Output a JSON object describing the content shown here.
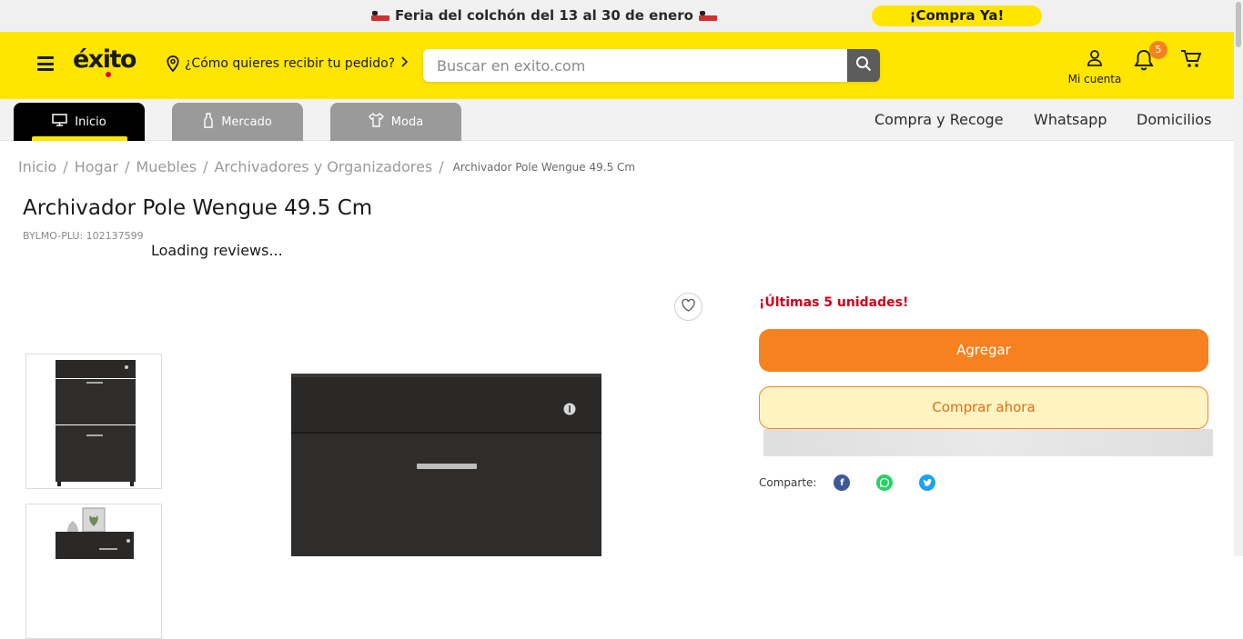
{
  "promo": {
    "text": "Feria del colchón del 13 al 30 de enero",
    "cta": "¡Compra Ya!"
  },
  "header": {
    "logo": "éxito",
    "delivery_prompt": "¿Cómo quieres recibir tu pedido?",
    "search_placeholder": "Buscar en exito.com",
    "account_label": "Mi cuenta",
    "notifications_count": "5"
  },
  "nav": {
    "tabs": [
      {
        "label": "Inicio",
        "icon": "monitor-icon",
        "active": true
      },
      {
        "label": "Mercado",
        "icon": "bottle-icon",
        "active": false
      },
      {
        "label": "Moda",
        "icon": "shirt-icon",
        "active": false
      }
    ],
    "links": [
      "Compra y Recoge",
      "Whatsapp",
      "Domicilios"
    ]
  },
  "breadcrumb": {
    "items": [
      "Inicio",
      "Hogar",
      "Muebles",
      "Archivadores y Organizadores"
    ],
    "current": "Archivador Pole Wengue 49.5 Cm"
  },
  "product": {
    "title": "Archivador Pole Wengue 49.5 Cm",
    "sku": "BYLMO-PLU: 102137599",
    "reviews_status": "Loading reviews...",
    "stock_alert": "¡Últimas 5 unidades!",
    "add_label": "Agregar",
    "buy_label": "Comprar ahora",
    "share_label": "Comparte:",
    "share_icons": [
      "facebook-icon",
      "whatsapp-icon",
      "twitter-icon"
    ]
  },
  "colors": {
    "brand_yellow": "#ffe600",
    "accent_orange": "#f5821f",
    "alert_red": "#d0021b"
  }
}
